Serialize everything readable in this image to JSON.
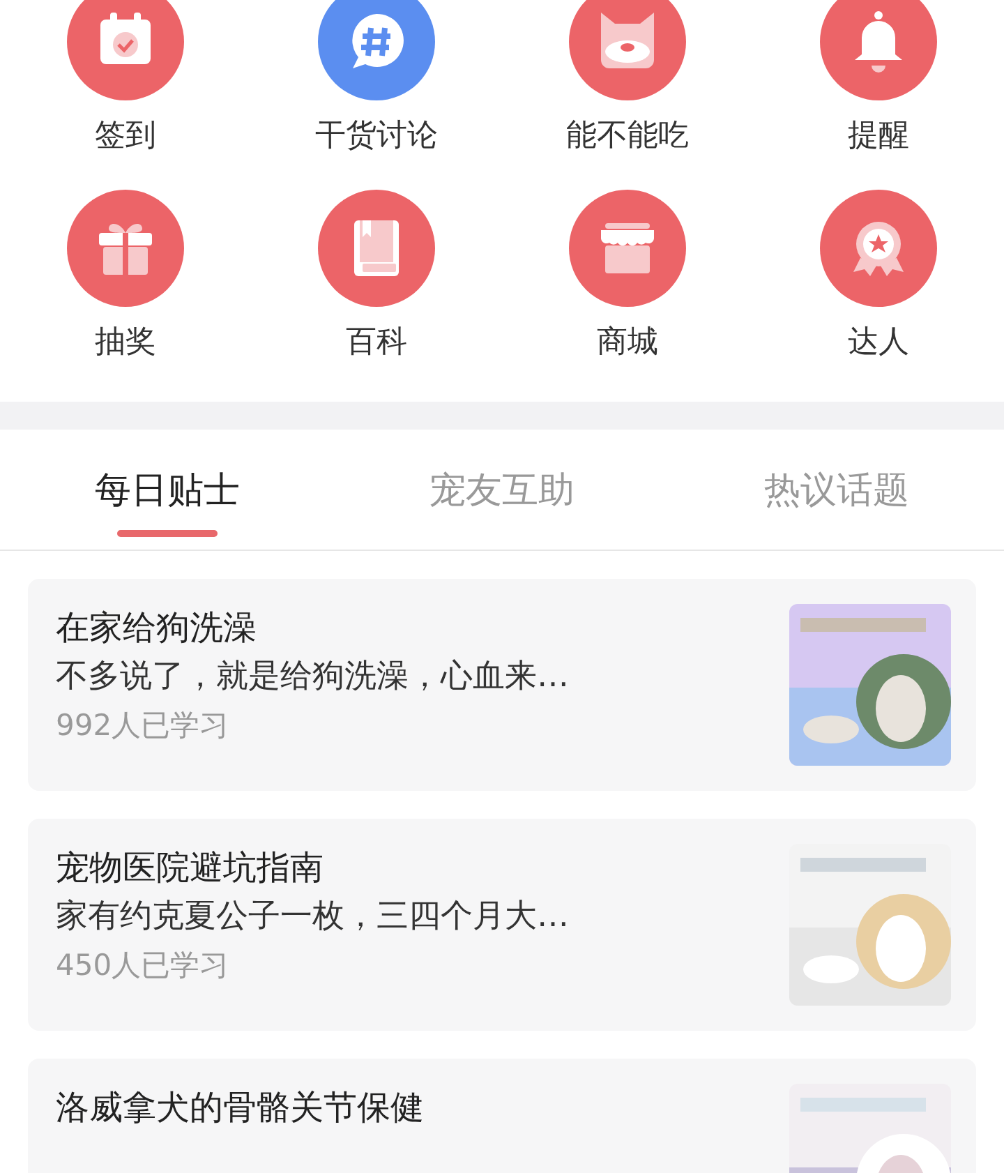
{
  "shortcuts": [
    {
      "label": "签到",
      "color": "#ec6468"
    },
    {
      "label": "干货讨论",
      "color": "#5b8ef0"
    },
    {
      "label": "能不能吃",
      "color": "#ec6468"
    },
    {
      "label": "提醒",
      "color": "#ec6468"
    },
    {
      "label": "抽奖",
      "color": "#ec6468"
    },
    {
      "label": "百科",
      "color": "#ec6468"
    },
    {
      "label": "商城",
      "color": "#ec6468"
    },
    {
      "label": "达人",
      "color": "#ec6468"
    }
  ],
  "tabs": [
    {
      "label": "每日贴士",
      "selected": true
    },
    {
      "label": "宠友互助",
      "selected": false
    },
    {
      "label": "热议话题",
      "selected": false
    }
  ],
  "articles": [
    {
      "title": "在家给狗洗澡",
      "summary": "不多说了，就是给狗洗澡，心血来…",
      "count": "992人已学习"
    },
    {
      "title": "宠物医院避坑指南",
      "summary": "家有约克夏公子一枚，三四个月大…",
      "count": "450人已学习"
    },
    {
      "title": "洛威拿犬的骨骼关节保健"
    }
  ]
}
